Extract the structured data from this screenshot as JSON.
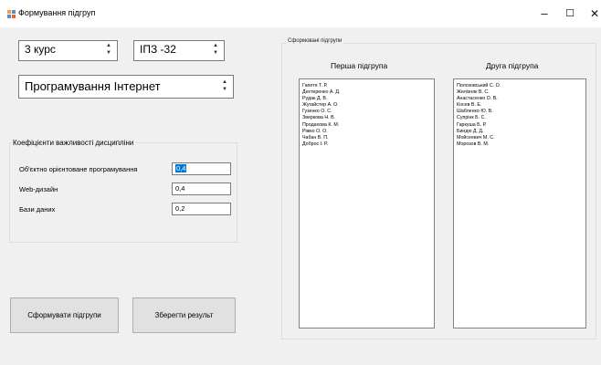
{
  "window": {
    "title": "Формування підгруп",
    "minimize": "–",
    "maximize": "☐",
    "close": "✕"
  },
  "spinners": {
    "course": "3 курс",
    "group": "ІПЗ -32",
    "subject": "Програмування Інтернет",
    "arrow_up": "▲",
    "arrow_down": "▼"
  },
  "coefficients": {
    "title": "Коефіцієнти важливості дисципліни",
    "rows": [
      {
        "label": "Об'єктно орієнтоване програмування",
        "value": "0,4"
      },
      {
        "label": "Web-дизайн",
        "value": "0,4"
      },
      {
        "label": "Бази даних",
        "value": "0,2"
      }
    ]
  },
  "buttons": {
    "form": "Сформувати підгрупи",
    "save": "Зберегти результ"
  },
  "groups": {
    "title": "Сформовані підгрупи",
    "first": {
      "header": "Перша підгрупа",
      "members": [
        "Гапетя Т. Р.",
        "Дехтеренко А. Д.",
        "Рудак Д. В.",
        "Жугайстер А. О.",
        "Гузенко О. С.",
        "Зверкова Н. В.",
        "Продахова К. М.",
        "Ріжко О. О.",
        "Чабан В. П.",
        "Доброс І. Р."
      ]
    },
    "second": {
      "header": "Друга підгрупа",
      "members": [
        "Полозовський С. О.",
        "Желізняк В. С.",
        "Анастасенко О. В.",
        "Косев В. Е.",
        "Шабленко Ю. В.",
        "Супрінк Б. С.",
        "Гаркуша Б. Р.",
        "Биндю Д. Д.",
        "Мойсеевич М. С.",
        "Морозов В. М."
      ]
    }
  }
}
